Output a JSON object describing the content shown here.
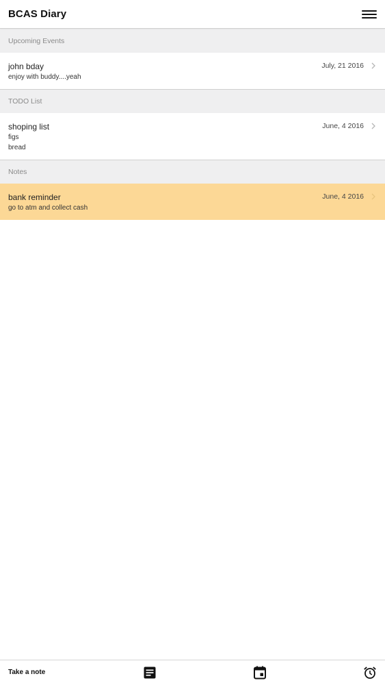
{
  "app": {
    "title": "BCAS Diary"
  },
  "sections": {
    "upcoming": {
      "label": "Upcoming Events",
      "item": {
        "title": "john bday",
        "lines": [
          "enjoy with buddy....yeah"
        ],
        "date": "July, 21 2016"
      }
    },
    "todo": {
      "label": "TODO List",
      "item": {
        "title": "shoping list",
        "lines": [
          "figs",
          "bread"
        ],
        "date": "June, 4 2016"
      }
    },
    "notes": {
      "label": "Notes",
      "item": {
        "title": "bank reminder",
        "lines": [
          "go to atm and collect cash"
        ],
        "date": "June, 4 2016"
      }
    }
  },
  "footer": {
    "take_note_label": "Take a note",
    "icons": [
      "note-icon",
      "calendar-icon",
      "alarm-clock-icon"
    ]
  },
  "colors": {
    "highlight": "#fcd896",
    "section_bg": "#efeff0"
  }
}
